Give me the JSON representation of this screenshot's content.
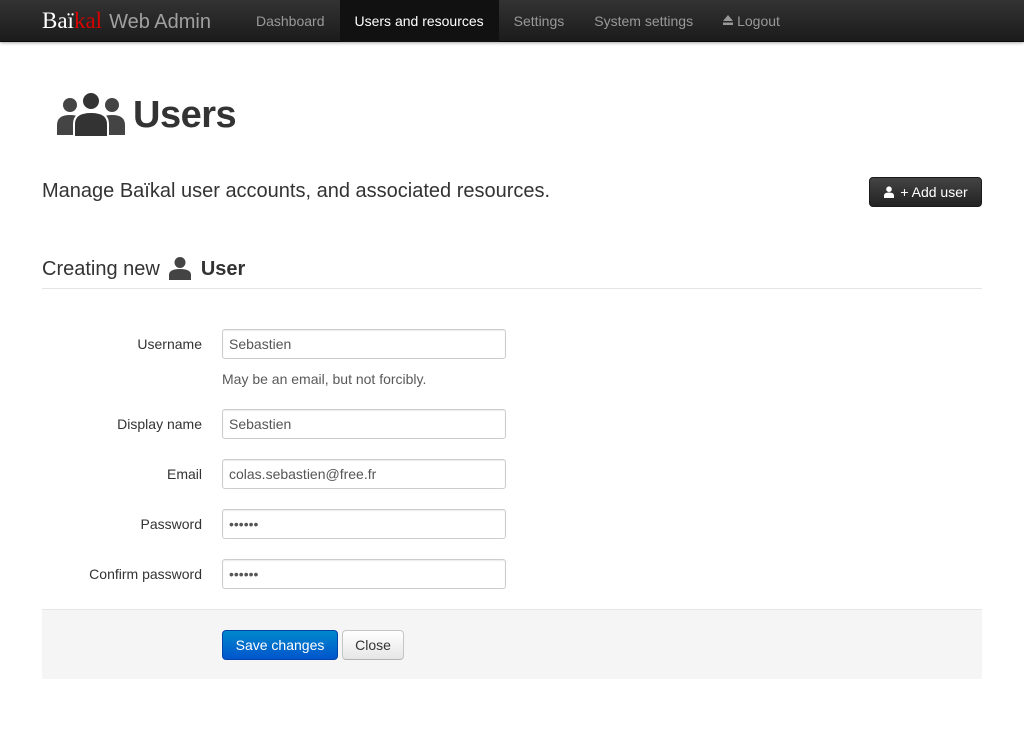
{
  "navbar": {
    "brand": {
      "bai": "Baï",
      "kal": "kal",
      "web_admin": "Web Admin"
    },
    "items": [
      {
        "label": "Dashboard",
        "active": false
      },
      {
        "label": "Users and resources",
        "active": true
      },
      {
        "label": "Settings",
        "active": false
      },
      {
        "label": "System settings",
        "active": false
      },
      {
        "label": "Logout",
        "active": false,
        "icon": "eject-icon"
      }
    ]
  },
  "header": {
    "icon": "users-group-icon",
    "title": "Users",
    "lead": "Manage Baïkal user accounts, and associated resources.",
    "add_user_label": "+ Add user",
    "add_user_icon": "user-icon"
  },
  "section": {
    "prefix": "Creating new",
    "icon": "user-icon",
    "object": "User"
  },
  "form": {
    "fields": [
      {
        "label": "Username",
        "value": "Sebastien",
        "type": "text"
      },
      {
        "label": "Display name",
        "value": "Sebastien",
        "type": "text"
      },
      {
        "label": "Email",
        "value": "colas.sebastien@free.fr",
        "type": "text"
      },
      {
        "label": "Password",
        "value": "secret",
        "type": "password"
      },
      {
        "label": "Confirm password",
        "value": "secret",
        "type": "password"
      }
    ],
    "username_help": "May be an email, but not forcibly.",
    "save_label": "Save changes",
    "close_label": "Close"
  },
  "colors": {
    "navbar": "#222222",
    "brand_accent": "#d90000",
    "primary": "#0074cc",
    "actions_bg": "#f5f5f5"
  }
}
